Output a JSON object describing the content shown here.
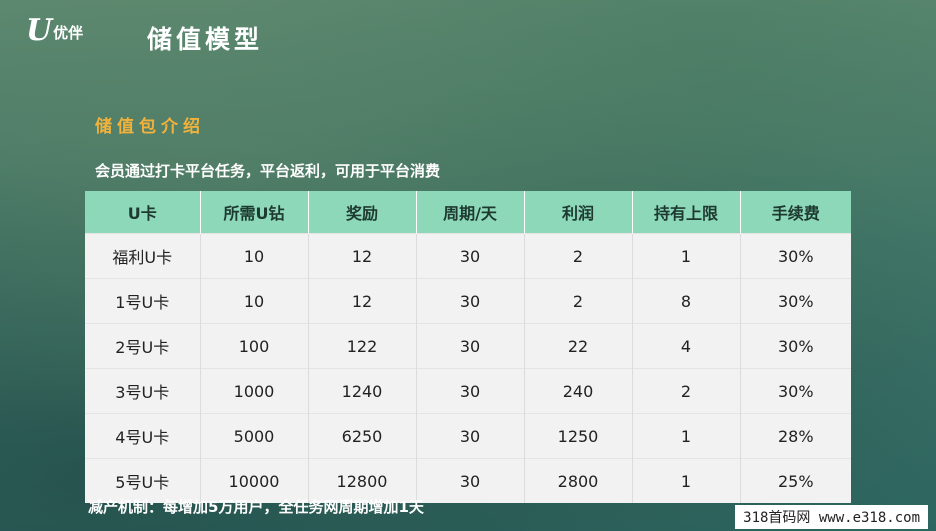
{
  "logo": {
    "mark": "U",
    "text": "优伴"
  },
  "title": "储值模型",
  "section_title": "储值包介绍",
  "intro": "会员通过打卡平台任务，平台返利，可用于平台消费",
  "table": {
    "headers": [
      "U卡",
      "所需U钻",
      "奖励",
      "周期/天",
      "利润",
      "持有上限",
      "手续费"
    ],
    "rows": [
      [
        "福利U卡",
        "10",
        "12",
        "30",
        "2",
        "1",
        "30%"
      ],
      [
        "1号U卡",
        "10",
        "12",
        "30",
        "2",
        "8",
        "30%"
      ],
      [
        "2号U卡",
        "100",
        "122",
        "30",
        "22",
        "4",
        "30%"
      ],
      [
        "3号U卡",
        "1000",
        "1240",
        "30",
        "240",
        "2",
        "30%"
      ],
      [
        "4号U卡",
        "5000",
        "6250",
        "30",
        "1250",
        "1",
        "28%"
      ],
      [
        "5号U卡",
        "10000",
        "12800",
        "30",
        "2800",
        "1",
        "25%"
      ]
    ]
  },
  "footer_note": "减产机制：每增加5万用户，全任务网周期增加1天",
  "watermark": "318首码网  www.e318.com"
}
